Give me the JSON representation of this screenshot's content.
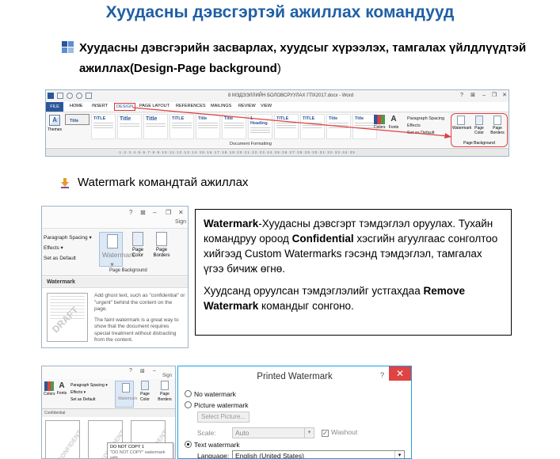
{
  "title": "Хуудасны дэвсгэртэй ажиллах командууд",
  "section1": {
    "text": "Хуудасны дэвсгэрийн засварлах, хуудсыг хүрээлэх, тамгалах үйлдлүүдтэй ажиллах(Design-Page background",
    "close_paren": ")"
  },
  "ribbon": {
    "doc_title": "8 МЭДЭЭЛЛИЙН БОЛОВСРУУЛАХ ГПХ2017.docx - Word",
    "tabs": [
      "FILE",
      "HOME",
      "INSERT",
      "DESIGN",
      "PAGE LAYOUT",
      "REFERENCES",
      "MAILINGS",
      "REVIEW",
      "VIEW"
    ],
    "themes_label": "Themes",
    "gallery": [
      "Title",
      "TITLE",
      "Title",
      "Title",
      "TITLE",
      "Title",
      "Title",
      "1 Heading",
      "TITLE",
      "TITLE",
      "Title",
      "Title"
    ],
    "doc_formatting": "Document Formatting",
    "colors_label": "Colors",
    "fonts_label": "Fonts",
    "paragraph_spacing": "Paragraph Spacing",
    "effects": "Effects",
    "set_default": "Set as Default",
    "watermark": "Watermark",
    "page_color": "Page Color",
    "page_borders": "Page Borders",
    "page_background": "Page Background",
    "accent_red": "#e04040",
    "accent_blue": "#2b579a"
  },
  "section2": {
    "text": "Watermark командтай ажиллах"
  },
  "wpanel": {
    "top_buttons": [
      "?",
      "⊠",
      "–",
      "❐",
      "✕"
    ],
    "sign": "Sign",
    "paragraph_spacing": "Paragraph Spacing ▾",
    "effects": "Effects ▾",
    "set_default": "Set as Default",
    "watermark": "Watermark",
    "page_color": "Page Color",
    "page_borders": "Page Borders",
    "group_label": "Page Background",
    "popup_title": "Watermark",
    "thumb_text": "DRAFT",
    "desc1": "Add ghost text, such as \"confidential\" or \"urgent\" behind the content on the page.",
    "desc2": "The faint watermark is a great way to show that the document requires special treatment without distracting from the content."
  },
  "textbox": {
    "p1_b1": "Watermark",
    "p1_t1": "-Хуудасны дэвсгэрт тэмдэглэл оруулах. Тухайн командруу ороод ",
    "p1_b2": "Confidential",
    "p1_t2": " хэсгийн агуулгаас сонголтоо хийгээд Custom Watermarks гэсэнд тэмдэглэл, тамгалах үгээ бичиж өгнө.",
    "p2_t1": "Хуудсанд оруулсан тэмдэглэлийг устгахдаа ",
    "p2_b1": "Remove Watermark",
    "p2_t2": " командыг сонгоно."
  },
  "bottom_left": {
    "top_buttons": [
      "?",
      "⊠",
      "–"
    ],
    "sign": "Sign",
    "colors": "Colors",
    "fonts": "Fonts",
    "paragraph_spacing": "Paragraph Spacing ▾",
    "effects": "Effects ▾",
    "set_default": "Set as Default",
    "watermark": "Watermark",
    "page_color": "Page Color",
    "page_borders": "Page Borders",
    "confidential": "Confidential",
    "page_text": "CONFIDENTIAL",
    "tip1": "DO NOT COPY 1",
    "tip2": "\"DO NOT COPY\" watermark with"
  },
  "dialog": {
    "title": "Printed Watermark",
    "help": "?",
    "close": "✕",
    "no_watermark": "No watermark",
    "picture_watermark": "Picture watermark",
    "select_picture": "Select Picture...",
    "scale_label": "Scale:",
    "scale_value": "Auto",
    "washout": "Washout",
    "text_watermark": "Text watermark",
    "language_label": "Language:",
    "language_value": "English (United States)"
  }
}
